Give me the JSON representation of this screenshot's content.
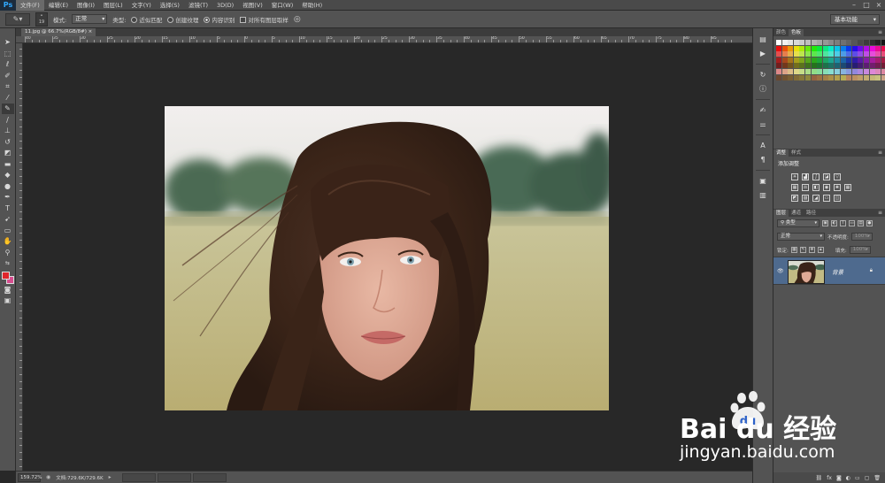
{
  "app": {
    "logo": "Ps"
  },
  "menu": {
    "items": [
      "文件(F)",
      "编辑(E)",
      "图像(I)",
      "图层(L)",
      "文字(Y)",
      "选择(S)",
      "滤镜(T)",
      "3D(D)",
      "视图(V)",
      "窗口(W)",
      "帮助(H)"
    ],
    "active_index": 0
  },
  "options": {
    "brush_size": "19",
    "mode_label": "模式:",
    "mode_value": "正常",
    "type_label": "类型:",
    "type_proximity": "近似匹配",
    "type_texture": "创建纹理",
    "type_content_aware": "内容识别",
    "sample_all_layers": "对所有图层取样",
    "workspace": "基本功能"
  },
  "document": {
    "tab_title": "11.jpg @ 66.7%(RGB/8#)",
    "ruler_labels": [
      "40",
      "35",
      "30",
      "25",
      "20",
      "15",
      "10",
      "5",
      "0",
      "5",
      "10",
      "15",
      "20",
      "25",
      "30",
      "35",
      "40",
      "45",
      "50",
      "55",
      "60",
      "65",
      "70",
      "75",
      "80",
      "85"
    ]
  },
  "status": {
    "zoom": "159.72%",
    "doc_info": "文档:729.6K/729.6K"
  },
  "panels": {
    "color_tab": "颜色",
    "swatches_tab": "色板",
    "adjust_tab": "调整",
    "styles_tab": "样式",
    "adjust_title": "添加调整",
    "layers_tab": "图层",
    "channels_tab": "通道",
    "paths_tab": "路径",
    "kind_filter": "类型",
    "blend_mode": "正常",
    "opacity_label": "不透明度:",
    "opacity_value": "100%",
    "lock_label": "锁定:",
    "fill_label": "填充:",
    "fill_value": "100%",
    "layer_name": "背景"
  },
  "watermark": {
    "brand": "Bai du 经验",
    "url": "jingyan.baidu.com"
  },
  "colors": {
    "accent": "#31a8ff",
    "foreground": "#e0262c",
    "background": "#d64d8f",
    "selected_layer": "#4e6a8e"
  }
}
